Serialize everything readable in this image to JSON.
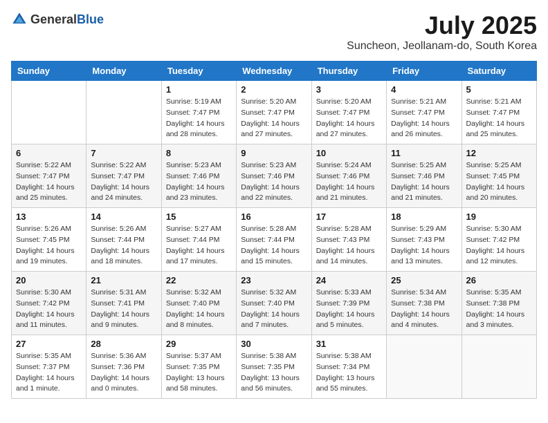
{
  "header": {
    "logo_general": "General",
    "logo_blue": "Blue",
    "month": "July 2025",
    "location": "Suncheon, Jeollanam-do, South Korea"
  },
  "days_of_week": [
    "Sunday",
    "Monday",
    "Tuesday",
    "Wednesday",
    "Thursday",
    "Friday",
    "Saturday"
  ],
  "weeks": [
    [
      {
        "day": "",
        "sunrise": "",
        "sunset": "",
        "daylight": ""
      },
      {
        "day": "",
        "sunrise": "",
        "sunset": "",
        "daylight": ""
      },
      {
        "day": "1",
        "sunrise": "Sunrise: 5:19 AM",
        "sunset": "Sunset: 7:47 PM",
        "daylight": "Daylight: 14 hours and 28 minutes."
      },
      {
        "day": "2",
        "sunrise": "Sunrise: 5:20 AM",
        "sunset": "Sunset: 7:47 PM",
        "daylight": "Daylight: 14 hours and 27 minutes."
      },
      {
        "day": "3",
        "sunrise": "Sunrise: 5:20 AM",
        "sunset": "Sunset: 7:47 PM",
        "daylight": "Daylight: 14 hours and 27 minutes."
      },
      {
        "day": "4",
        "sunrise": "Sunrise: 5:21 AM",
        "sunset": "Sunset: 7:47 PM",
        "daylight": "Daylight: 14 hours and 26 minutes."
      },
      {
        "day": "5",
        "sunrise": "Sunrise: 5:21 AM",
        "sunset": "Sunset: 7:47 PM",
        "daylight": "Daylight: 14 hours and 25 minutes."
      }
    ],
    [
      {
        "day": "6",
        "sunrise": "Sunrise: 5:22 AM",
        "sunset": "Sunset: 7:47 PM",
        "daylight": "Daylight: 14 hours and 25 minutes."
      },
      {
        "day": "7",
        "sunrise": "Sunrise: 5:22 AM",
        "sunset": "Sunset: 7:47 PM",
        "daylight": "Daylight: 14 hours and 24 minutes."
      },
      {
        "day": "8",
        "sunrise": "Sunrise: 5:23 AM",
        "sunset": "Sunset: 7:46 PM",
        "daylight": "Daylight: 14 hours and 23 minutes."
      },
      {
        "day": "9",
        "sunrise": "Sunrise: 5:23 AM",
        "sunset": "Sunset: 7:46 PM",
        "daylight": "Daylight: 14 hours and 22 minutes."
      },
      {
        "day": "10",
        "sunrise": "Sunrise: 5:24 AM",
        "sunset": "Sunset: 7:46 PM",
        "daylight": "Daylight: 14 hours and 21 minutes."
      },
      {
        "day": "11",
        "sunrise": "Sunrise: 5:25 AM",
        "sunset": "Sunset: 7:46 PM",
        "daylight": "Daylight: 14 hours and 21 minutes."
      },
      {
        "day": "12",
        "sunrise": "Sunrise: 5:25 AM",
        "sunset": "Sunset: 7:45 PM",
        "daylight": "Daylight: 14 hours and 20 minutes."
      }
    ],
    [
      {
        "day": "13",
        "sunrise": "Sunrise: 5:26 AM",
        "sunset": "Sunset: 7:45 PM",
        "daylight": "Daylight: 14 hours and 19 minutes."
      },
      {
        "day": "14",
        "sunrise": "Sunrise: 5:26 AM",
        "sunset": "Sunset: 7:44 PM",
        "daylight": "Daylight: 14 hours and 18 minutes."
      },
      {
        "day": "15",
        "sunrise": "Sunrise: 5:27 AM",
        "sunset": "Sunset: 7:44 PM",
        "daylight": "Daylight: 14 hours and 17 minutes."
      },
      {
        "day": "16",
        "sunrise": "Sunrise: 5:28 AM",
        "sunset": "Sunset: 7:44 PM",
        "daylight": "Daylight: 14 hours and 15 minutes."
      },
      {
        "day": "17",
        "sunrise": "Sunrise: 5:28 AM",
        "sunset": "Sunset: 7:43 PM",
        "daylight": "Daylight: 14 hours and 14 minutes."
      },
      {
        "day": "18",
        "sunrise": "Sunrise: 5:29 AM",
        "sunset": "Sunset: 7:43 PM",
        "daylight": "Daylight: 14 hours and 13 minutes."
      },
      {
        "day": "19",
        "sunrise": "Sunrise: 5:30 AM",
        "sunset": "Sunset: 7:42 PM",
        "daylight": "Daylight: 14 hours and 12 minutes."
      }
    ],
    [
      {
        "day": "20",
        "sunrise": "Sunrise: 5:30 AM",
        "sunset": "Sunset: 7:42 PM",
        "daylight": "Daylight: 14 hours and 11 minutes."
      },
      {
        "day": "21",
        "sunrise": "Sunrise: 5:31 AM",
        "sunset": "Sunset: 7:41 PM",
        "daylight": "Daylight: 14 hours and 9 minutes."
      },
      {
        "day": "22",
        "sunrise": "Sunrise: 5:32 AM",
        "sunset": "Sunset: 7:40 PM",
        "daylight": "Daylight: 14 hours and 8 minutes."
      },
      {
        "day": "23",
        "sunrise": "Sunrise: 5:32 AM",
        "sunset": "Sunset: 7:40 PM",
        "daylight": "Daylight: 14 hours and 7 minutes."
      },
      {
        "day": "24",
        "sunrise": "Sunrise: 5:33 AM",
        "sunset": "Sunset: 7:39 PM",
        "daylight": "Daylight: 14 hours and 5 minutes."
      },
      {
        "day": "25",
        "sunrise": "Sunrise: 5:34 AM",
        "sunset": "Sunset: 7:38 PM",
        "daylight": "Daylight: 14 hours and 4 minutes."
      },
      {
        "day": "26",
        "sunrise": "Sunrise: 5:35 AM",
        "sunset": "Sunset: 7:38 PM",
        "daylight": "Daylight: 14 hours and 3 minutes."
      }
    ],
    [
      {
        "day": "27",
        "sunrise": "Sunrise: 5:35 AM",
        "sunset": "Sunset: 7:37 PM",
        "daylight": "Daylight: 14 hours and 1 minute."
      },
      {
        "day": "28",
        "sunrise": "Sunrise: 5:36 AM",
        "sunset": "Sunset: 7:36 PM",
        "daylight": "Daylight: 14 hours and 0 minutes."
      },
      {
        "day": "29",
        "sunrise": "Sunrise: 5:37 AM",
        "sunset": "Sunset: 7:35 PM",
        "daylight": "Daylight: 13 hours and 58 minutes."
      },
      {
        "day": "30",
        "sunrise": "Sunrise: 5:38 AM",
        "sunset": "Sunset: 7:35 PM",
        "daylight": "Daylight: 13 hours and 56 minutes."
      },
      {
        "day": "31",
        "sunrise": "Sunrise: 5:38 AM",
        "sunset": "Sunset: 7:34 PM",
        "daylight": "Daylight: 13 hours and 55 minutes."
      },
      {
        "day": "",
        "sunrise": "",
        "sunset": "",
        "daylight": ""
      },
      {
        "day": "",
        "sunrise": "",
        "sunset": "",
        "daylight": ""
      }
    ]
  ]
}
